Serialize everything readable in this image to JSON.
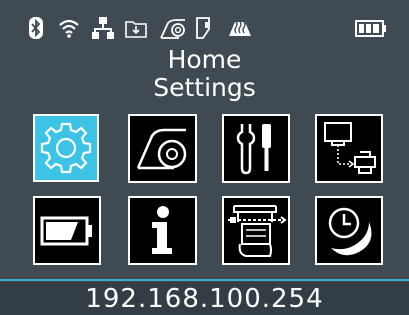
{
  "status_bar": {
    "icons": [
      "bluetooth-icon",
      "wifi-icon",
      "network-icon",
      "download-folder-icon",
      "ribbon-icon",
      "media-door-icon",
      "heat-icon",
      "battery-icon"
    ]
  },
  "header": {
    "title_line1": "Home",
    "title_line2": "Settings"
  },
  "menu": {
    "selected": "settings",
    "items": [
      {
        "id": "settings",
        "icon": "gear-icon"
      },
      {
        "id": "media",
        "icon": "label-roll-icon"
      },
      {
        "id": "tools",
        "icon": "tools-icon"
      },
      {
        "id": "connection",
        "icon": "computer-printer-icon"
      },
      {
        "id": "battery",
        "icon": "battery-icon"
      },
      {
        "id": "information",
        "icon": "info-icon"
      },
      {
        "id": "print",
        "icon": "printer-feed-icon"
      },
      {
        "id": "sleep",
        "icon": "sleep-timer-icon"
      }
    ]
  },
  "footer": {
    "ip_address": "192.168.100.254"
  },
  "colors": {
    "background": "#3f4a52",
    "accent": "#3cc3e6",
    "divider": "#3da9d3"
  }
}
